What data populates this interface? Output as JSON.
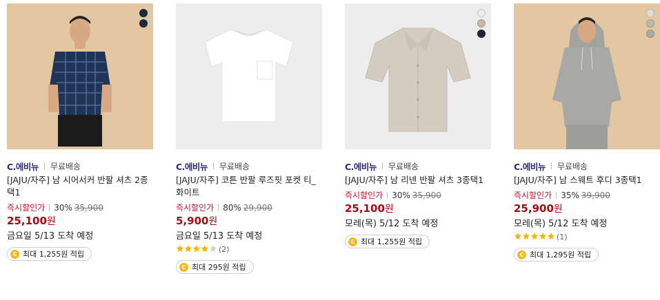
{
  "products": [
    {
      "brand": "C.에비뉴",
      "shipping": "무료배송",
      "title": "[JAJU/자주] 남 시어서커 반팔 셔츠 2종 택1",
      "price_label": "즉시할인가",
      "discount": "30%",
      "original_price": "35,900",
      "price": "25,100",
      "won": "원",
      "arrival": "금요일 5/13 도착 예정",
      "rating_stars": null,
      "review_count": null,
      "points": "최대 1,255원 적립",
      "swatch_colors": [
        "#1d2a3c",
        "#1d2a3c"
      ]
    },
    {
      "brand": "C.에비뉴",
      "shipping": "무료배송",
      "title": "[JAJU/자주] 코튼 반팔 루즈핏 포켓 티_화이트",
      "price_label": "즉시할인가",
      "discount": "80%",
      "original_price": "29,900",
      "price": "5,900",
      "won": "원",
      "arrival": "금요일 5/13 도착 예정",
      "rating_stars": 4,
      "review_count": "(2)",
      "points": "최대 295원 적립",
      "swatch_colors": []
    },
    {
      "brand": "C.에비뉴",
      "shipping": "무료배송",
      "title": "[JAJU/자주] 남 리넨 반팔 셔츠 3종택1",
      "price_label": "즉시할인가",
      "discount": "30%",
      "original_price": "35,900",
      "price": "25,100",
      "won": "원",
      "arrival": "모레(목) 5/12 도착 예정",
      "rating_stars": null,
      "review_count": null,
      "points": "최대 1,255원 적립",
      "swatch_colors": [
        "#ecebf0",
        "#c9b8a3",
        "#1f2637"
      ]
    },
    {
      "brand": "C.에비뉴",
      "shipping": "무료배송",
      "title": "[JAJU/자주] 남 스웨트 후디 3종택1",
      "price_label": "즉시할인가",
      "discount": "35%",
      "original_price": "39,900",
      "price": "25,900",
      "won": "원",
      "arrival": "모레(목) 5/12 도착 예정",
      "rating_stars": 5,
      "review_count": "(1)",
      "points": "최대 1,295원 적립",
      "swatch_colors": [
        "#e0dcd6",
        "#bdb7ac",
        "#a9aaa4"
      ]
    }
  ],
  "coin_glyph": "C",
  "colors": {
    "brand": "#2d2a72",
    "price_label": "#c8132b",
    "price": "#a50a12",
    "star": "#f5b400",
    "coin": "#f5b81d"
  }
}
